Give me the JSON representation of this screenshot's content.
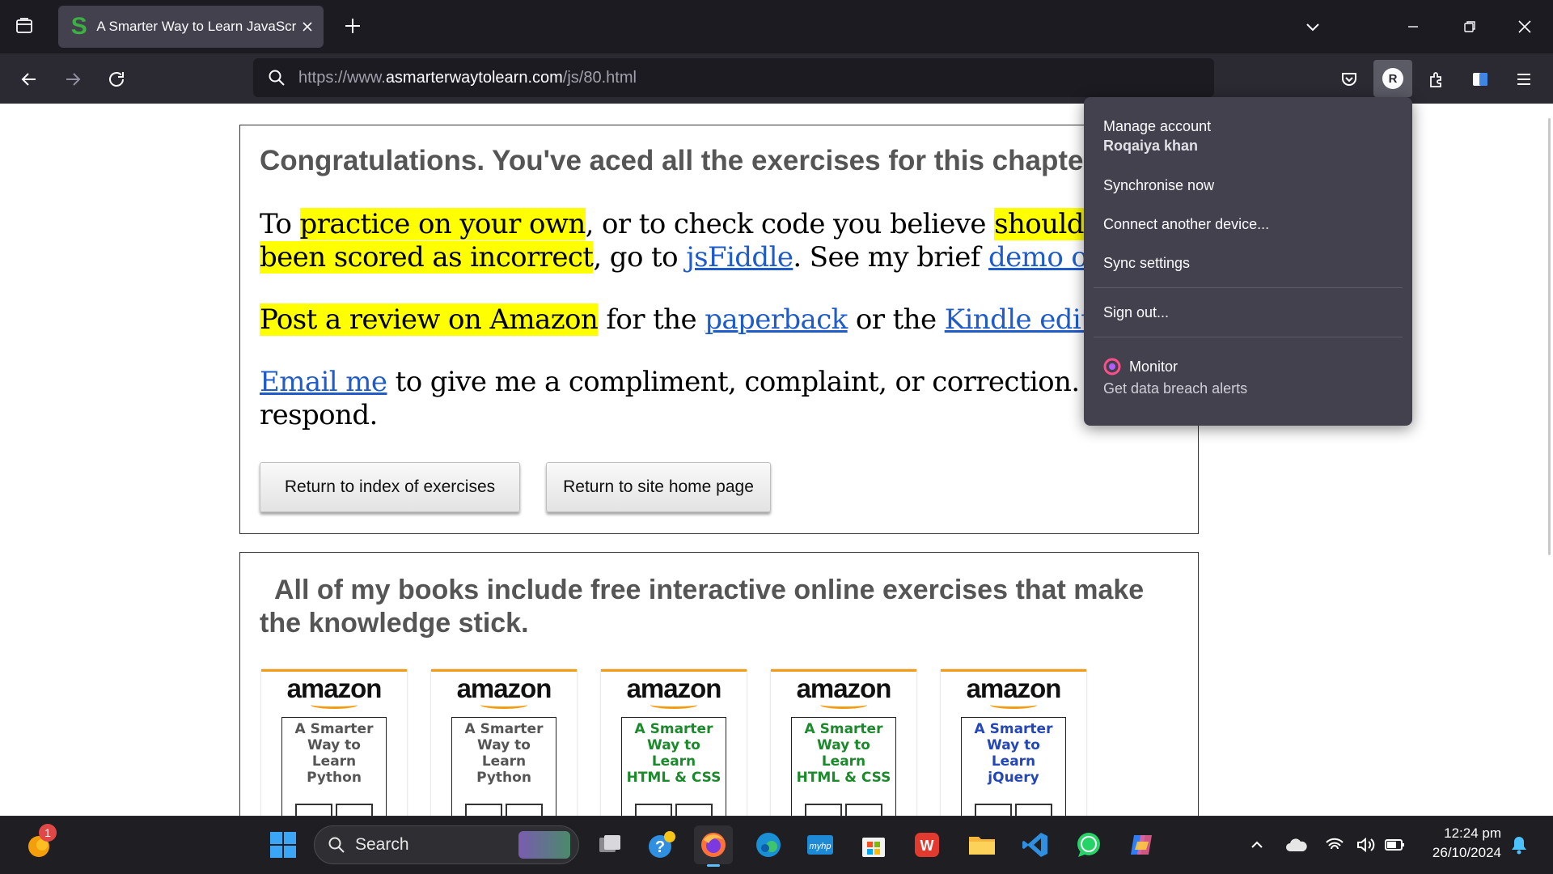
{
  "browser": {
    "tab_title": "A Smarter Way to Learn JavaScr",
    "favicon_letter": "S",
    "url_prefix": "https://www.",
    "url_domain": "asmarterwaytolearn.com",
    "url_path": "/js/80.html",
    "avatar_letter": "R",
    "accent_color": "#1c1b22"
  },
  "page": {
    "congrats_heading": "Congratulations. You've aced all the exercises for this chapte",
    "p1": {
      "t1": "To ",
      "h1": "practice on your own",
      "t2": ", or to check code you believe ",
      "h2": "shouldn't h",
      "h3": "been scored as incorrect",
      "t3": ", go to ",
      "link1": "jsFiddle",
      "t4": ". See my brief ",
      "link2": "demo of jsF"
    },
    "p2": {
      "h1": "Post a review on Amazon",
      "t1": " for the ",
      "link1": "paperback",
      "t2": " or the ",
      "link2": "Kindle edition"
    },
    "p3": {
      "link1": "Email me",
      "t1": " to give me a compliment, complaint, or correction. I'll",
      "t2": "respond."
    },
    "btn_index": "Return to index of exercises",
    "btn_home": "Return to site home page",
    "books_heading_line1": "All of my books include free interactive online exercises that make",
    "books_heading_line2": "the knowledge stick.",
    "books": [
      {
        "brand": "amazon",
        "title_l1": "A Smarter",
        "title_l2": "Way to",
        "title_l3": "Learn",
        "title_l4": "Python",
        "color": "#555555"
      },
      {
        "brand": "amazon",
        "title_l1": "A Smarter",
        "title_l2": "Way to",
        "title_l3": "Learn",
        "title_l4": "Python",
        "color": "#555555"
      },
      {
        "brand": "amazon",
        "title_l1": "A Smarter",
        "title_l2": "Way to",
        "title_l3": "Learn",
        "title_l4": "HTML & CSS",
        "color": "#1a8a2a"
      },
      {
        "brand": "amazon",
        "title_l1": "A Smarter",
        "title_l2": "Way to",
        "title_l3": "Learn",
        "title_l4": "HTML & CSS",
        "color": "#1a8a2a"
      },
      {
        "brand": "amazon",
        "title_l1": "A Smarter",
        "title_l2": "Way to",
        "title_l3": "Learn",
        "title_l4": "jQuery",
        "color": "#2346b8"
      }
    ]
  },
  "account_menu": {
    "manage_account": "Manage account",
    "user_name": "Roqaiya khan",
    "sync_now": "Synchronise now",
    "connect_device": "Connect another device...",
    "sync_settings": "Sync settings",
    "sign_out": "Sign out...",
    "monitor_title": "Monitor",
    "monitor_desc": "Get data breach alerts"
  },
  "taskbar": {
    "search_label": "Search",
    "notification_count": "1",
    "time": "12:24 pm",
    "date": "26/10/2024"
  }
}
